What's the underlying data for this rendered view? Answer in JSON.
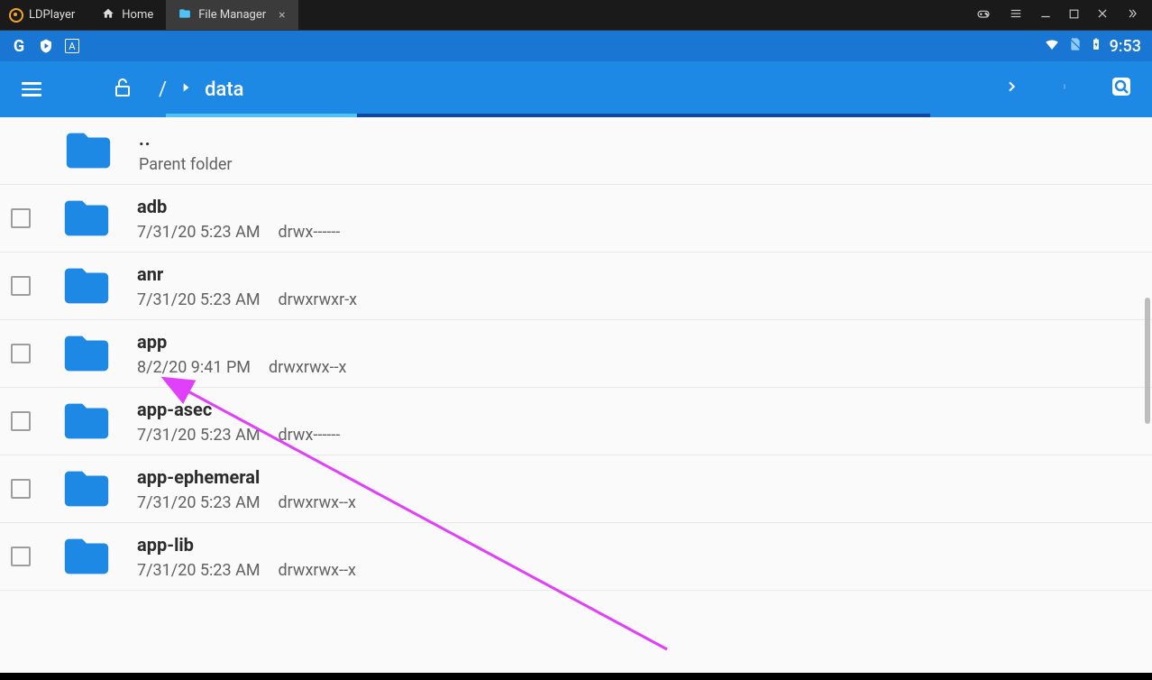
{
  "window": {
    "brand": "LDPlayer",
    "tabs": [
      {
        "label": "Home",
        "icon": "home-icon",
        "active": false
      },
      {
        "label": "File Manager",
        "icon": "folder-icon",
        "active": true
      }
    ]
  },
  "status_bar": {
    "time": "9:53"
  },
  "toolbar": {
    "breadcrumb_root": "/",
    "breadcrumb_current": "data"
  },
  "parent_row": {
    "name": "..",
    "sub": "Parent folder"
  },
  "folders": [
    {
      "name": "adb",
      "date": "7/31/20 5:23 AM",
      "perm": "drwx------"
    },
    {
      "name": "anr",
      "date": "7/31/20 5:23 AM",
      "perm": "drwxrwxr-x"
    },
    {
      "name": "app",
      "date": "8/2/20 9:41 PM",
      "perm": "drwxrwx--x"
    },
    {
      "name": "app-asec",
      "date": "7/31/20 5:23 AM",
      "perm": "drwx------"
    },
    {
      "name": "app-ephemeral",
      "date": "7/31/20 5:23 AM",
      "perm": "drwxrwx--x"
    },
    {
      "name": "app-lib",
      "date": "7/31/20 5:23 AM",
      "perm": "drwxrwx--x"
    }
  ],
  "annotation": {
    "arrow_color": "#e040fb",
    "points_to": "folders.2"
  }
}
